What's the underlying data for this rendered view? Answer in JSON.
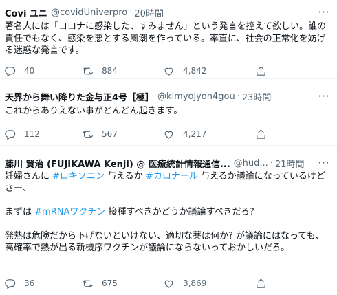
{
  "tweets": [
    {
      "name": "Covi ユニ",
      "handle": "@covidUniverpro",
      "separator": "·",
      "time": "20時間",
      "text": "著名人には「コロナに感染した、すみません」という発言を控えて欲しい。誰の責任でもなく、感染を悪とする風潮を作っている。率直に、社会の正常化を妨げる迷惑な発言です。",
      "replies": "40",
      "retweets": "884",
      "likes": "4,842"
    },
    {
      "name": "天界から舞い降りた金与正4号［極］",
      "handle": "@kimyojyon4gou",
      "separator": "·",
      "time": "23時間",
      "text": "これからありえない事がどんどん起きます。",
      "replies": "112",
      "retweets": "567",
      "likes": "4,217"
    },
    {
      "name": "藤川 賢治 (FUJIKAWA Kenji) @ 医療統計情報通信...",
      "handle": "@hud...",
      "separator": "·",
      "time": "21時間",
      "text_parts": {
        "p1a": "妊婦さんに ",
        "p1h1": "#ロキソニン",
        "p1b": " 与えるか ",
        "p1h2": "#カロナール",
        "p1c": " 与えるか議論になっているけどさー、",
        "p2a": "まずは ",
        "p2h": "#mRNAワクチン",
        "p2b": " 接種すべきかどうか議論すべきだろ?",
        "p3": "発熱は危険だから下げないといけない、適切な薬は何か? が議論にはなっても、高確率で熱が出る新機序ワクチンが議論にならないっておかしいだろ。"
      },
      "replies": "36",
      "retweets": "675",
      "likes": "3,869"
    }
  ],
  "more_glyph": "···",
  "colors": {
    "text": "#0f1419",
    "muted": "#536471",
    "link": "#1d9bf0",
    "divider": "#eff3f4"
  },
  "icons": [
    "reply-icon",
    "retweet-icon",
    "like-icon",
    "share-icon",
    "more-icon"
  ]
}
